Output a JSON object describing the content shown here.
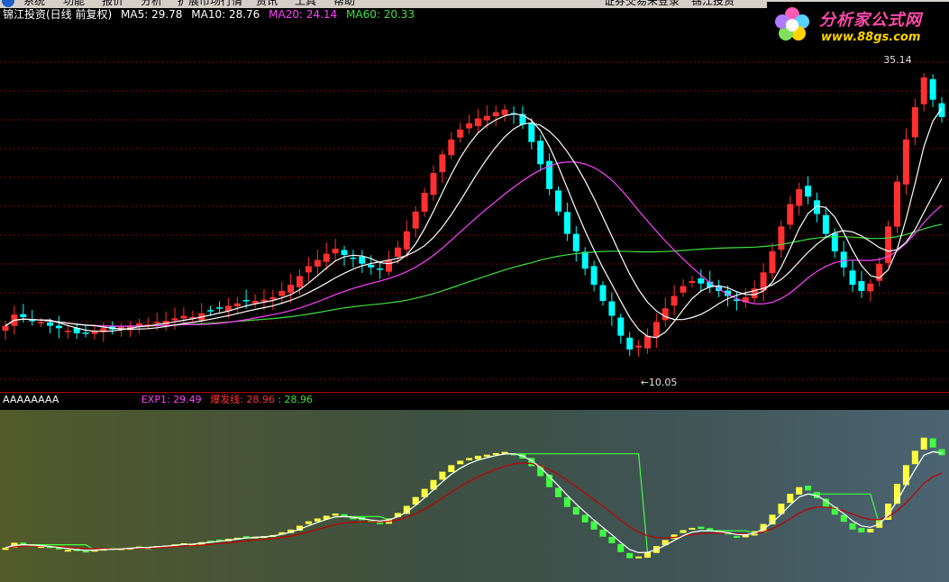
{
  "menu": {
    "items": [
      "系统",
      "功能",
      "报价",
      "分析",
      "扩展市场行情",
      "资讯",
      "工具",
      "帮助"
    ],
    "status": "证券交易未登录",
    "account": "锦江投资"
  },
  "brand": {
    "name": "分析家公式网",
    "url": "www.88gs.com"
  },
  "main": {
    "title": "锦江投资(日线 前复权)",
    "ma": [
      {
        "label": "MA5: 29.78",
        "color": "#ffffff"
      },
      {
        "label": "MA10: 28.76",
        "color": "#ffffff"
      },
      {
        "label": "MA20: 24.14",
        "color": "#ff40ff"
      },
      {
        "label": "MA60: 20.33",
        "color": "#40e040"
      }
    ],
    "high_label": "35.14",
    "low_label": "10.05"
  },
  "indicator": {
    "name": "AAAAAAAA",
    "exp1": "EXP1: 29.49",
    "line_label": "爆发线: 28.96",
    "last_value": ": 28.96"
  },
  "colors": {
    "up": "#ff3030",
    "down": "#00ffff",
    "ma60": "#40e040",
    "ma20": "#ff40ff",
    "ind_up": "#ffff40",
    "ind_down": "#40ff40",
    "ind_line": "#c00000"
  },
  "chart_data": {
    "type": "candlestick",
    "ylim": [
      9,
      37
    ],
    "closes": [
      13.6,
      14.5,
      14.3,
      14.0,
      13.9,
      13.6,
      13.4,
      13.2,
      13.0,
      13.0,
      13.2,
      13.4,
      13.3,
      13.5,
      13.6,
      13.8,
      13.7,
      13.9,
      14.0,
      14.2,
      14.4,
      14.3,
      14.6,
      14.8,
      15.0,
      15.2,
      15.4,
      15.6,
      15.6,
      15.7,
      15.9,
      16.4,
      16.9,
      17.6,
      18.4,
      18.9,
      19.4,
      19.8,
      19.3,
      19.0,
      18.6,
      18.3,
      18.2,
      18.9,
      19.9,
      21.2,
      22.8,
      24.3,
      25.9,
      27.4,
      28.6,
      29.4,
      29.9,
      30.3,
      30.5,
      30.8,
      31.0,
      30.7,
      29.8,
      28.4,
      26.6,
      24.6,
      22.8,
      21.0,
      19.6,
      18.2,
      16.9,
      15.6,
      14.4,
      12.8,
      11.7,
      12.0,
      12.8,
      13.9,
      15.0,
      16.0,
      16.8,
      17.2,
      17.0,
      16.7,
      16.4,
      16.0,
      15.6,
      15.9,
      16.6,
      17.9,
      19.6,
      21.6,
      23.4,
      24.6,
      24.0,
      22.6,
      21.0,
      19.6,
      18.3,
      16.9,
      16.4,
      17.0,
      18.6,
      21.6,
      25.2,
      28.6,
      31.2,
      33.6,
      31.8,
      30.4
    ]
  }
}
